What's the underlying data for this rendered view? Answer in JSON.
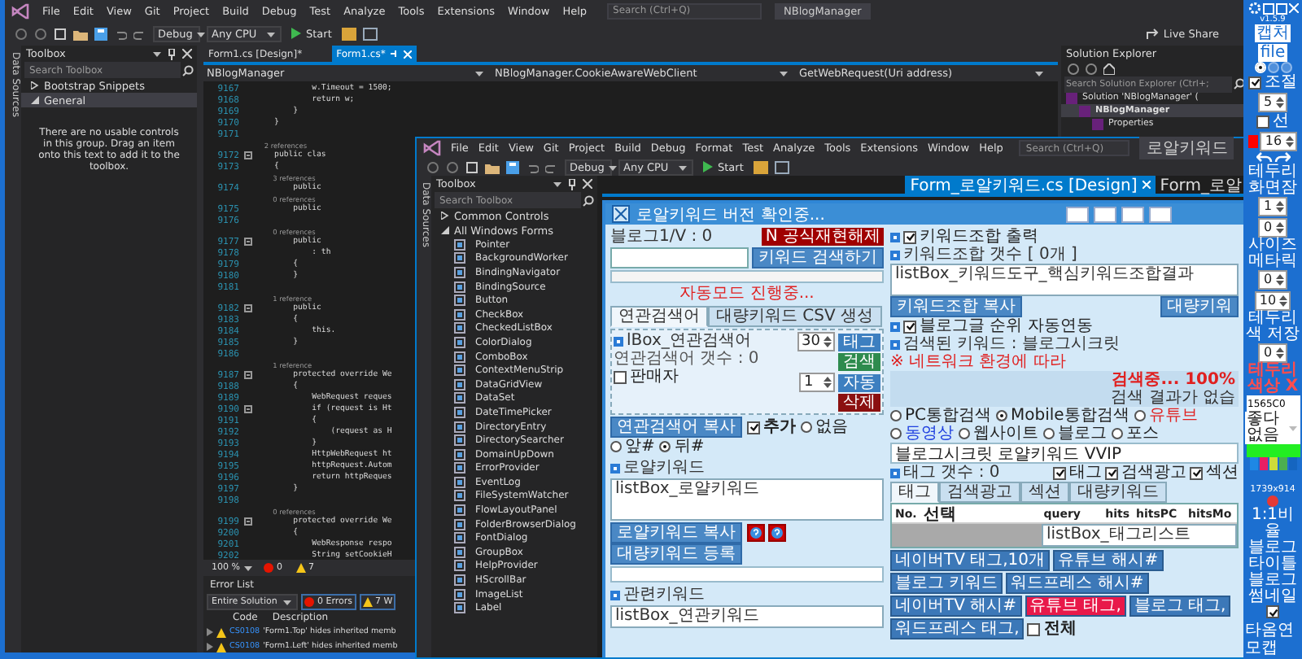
{
  "ide": {
    "menu": [
      "File",
      "Edit",
      "View",
      "Git",
      "Project",
      "Build",
      "Debug",
      "Test",
      "Analyze",
      "Tools",
      "Extensions",
      "Window",
      "Help"
    ],
    "search": {
      "placeholder": "Search (Ctrl+Q)"
    },
    "solution_name": "NBlogManager",
    "toolbar": {
      "configuration": "Debug",
      "platform": "Any CPU",
      "start": "Start",
      "live_share": "Live Share"
    },
    "side_tab": "Data Sources",
    "toolbox": {
      "title": "Toolbox",
      "search": {
        "placeholder": "Search Toolbox"
      },
      "groups": [
        {
          "label": "Bootstrap Snippets",
          "expanded": false,
          "selected": false
        },
        {
          "label": "General",
          "expanded": true,
          "selected": true
        }
      ],
      "message": "There are no usable controls in this group. Drag an item onto this text to add it to the toolbox."
    },
    "doc_tabs": [
      {
        "label": "Form1.cs [Design]*",
        "selected": false
      },
      {
        "label": "Form1.cs*",
        "selected": true
      }
    ],
    "nav_bar": [
      "NBlogManager",
      "NBlogManager.CookieAwareWebClient",
      "GetWebRequest(Uri address)"
    ],
    "code_lines": [
      {
        "kind": "code",
        "number": "9167",
        "text": "            w.Timeout = 1500;",
        "fold": false
      },
      {
        "kind": "code",
        "number": "9168",
        "text": "            return w;",
        "fold": false
      },
      {
        "kind": "code",
        "number": "9169",
        "text": "        }",
        "fold": false
      },
      {
        "kind": "code",
        "number": "9170",
        "text": "    }",
        "fold": false
      },
      {
        "kind": "code",
        "number": "9171",
        "fold": false
      },
      {
        "kind": "lens",
        "text": "    2 references"
      },
      {
        "kind": "code",
        "number": "9172",
        "text": "    public clas",
        "fold": true
      },
      {
        "kind": "code",
        "number": "9173",
        "text": "    {",
        "fold": false
      },
      {
        "kind": "lens",
        "text": "        3 references"
      },
      {
        "kind": "code",
        "number": "9174",
        "text": "        public",
        "fold": false
      },
      {
        "kind": "lens",
        "text": "        0 references"
      },
      {
        "kind": "code",
        "number": "9175",
        "text": "        public",
        "fold": false
      },
      {
        "kind": "code",
        "number": "9176",
        "fold": false
      },
      {
        "kind": "lens",
        "text": "        0 references"
      },
      {
        "kind": "code",
        "number": "9177",
        "text": "        public",
        "fold": true
      },
      {
        "kind": "code",
        "number": "9178",
        "text": "            : th",
        "fold": false
      },
      {
        "kind": "code",
        "number": "9179",
        "text": "        {",
        "fold": false
      },
      {
        "kind": "code",
        "number": "9180",
        "text": "        }",
        "fold": false
      },
      {
        "kind": "code",
        "number": "9181",
        "fold": false
      },
      {
        "kind": "lens",
        "text": "        1 reference"
      },
      {
        "kind": "code",
        "number": "9182",
        "text": "        public",
        "fold": true
      },
      {
        "kind": "code",
        "number": "9183",
        "text": "        {",
        "fold": false
      },
      {
        "kind": "code",
        "number": "9184",
        "text": "            this.",
        "fold": false
      },
      {
        "kind": "code",
        "number": "9185",
        "text": "        }",
        "fold": false
      },
      {
        "kind": "code",
        "number": "9186",
        "fold": false
      },
      {
        "kind": "lens",
        "text": "        1 reference"
      },
      {
        "kind": "code",
        "number": "9187",
        "text": "        protected override We",
        "fold": true
      },
      {
        "kind": "code",
        "number": "9188",
        "text": "        {",
        "fold": false
      },
      {
        "kind": "code",
        "number": "9189",
        "text": "            WebRequest reques",
        "fold": false
      },
      {
        "kind": "code",
        "number": "9190",
        "text": "            if (request is Ht",
        "fold": true
      },
      {
        "kind": "code",
        "number": "9191",
        "text": "            {",
        "fold": false
      },
      {
        "kind": "code",
        "number": "9192",
        "text": "                (request as H",
        "fold": false
      },
      {
        "kind": "code",
        "number": "9193",
        "text": "            }",
        "fold": false
      },
      {
        "kind": "code",
        "number": "9194",
        "text": "            HttpWebRequest ht",
        "fold": false
      },
      {
        "kind": "code",
        "number": "9195",
        "text": "            httpRequest.Autom",
        "fold": false
      },
      {
        "kind": "code",
        "number": "9196",
        "text": "            return httpReques",
        "fold": false
      },
      {
        "kind": "code",
        "number": "9197",
        "text": "        }",
        "fold": false
      },
      {
        "kind": "code",
        "number": "9198",
        "fold": false
      },
      {
        "kind": "lens",
        "text": "        0 references"
      },
      {
        "kind": "code",
        "number": "9199",
        "text": "        protected override We",
        "fold": true
      },
      {
        "kind": "code",
        "number": "9200",
        "text": "        {",
        "fold": false
      },
      {
        "kind": "code",
        "number": "9201",
        "text": "            WebResponse respo",
        "fold": false
      },
      {
        "kind": "code",
        "number": "9202",
        "text": "            String setCookieH",
        "fold": false
      }
    ],
    "editor_status": {
      "zoom": "100 %",
      "errors": "0",
      "warnings": "7"
    },
    "error_list": {
      "title": "Error List",
      "scope": "Entire Solution",
      "errors": "0 Errors",
      "warnings": "7 W",
      "columns": [
        "Code",
        "Description"
      ],
      "rows": [
        {
          "code": "CS0108",
          "description": "'Form1.Top' hides inherited memb"
        },
        {
          "code": "CS0108",
          "description": "'Form1.Left' hides inherited memb"
        }
      ]
    },
    "solution_explorer": {
      "title": "Solution Explorer",
      "search": {
        "placeholder": "Search Solution Explorer (Ctrl+;"
      },
      "tree": [
        {
          "label": "Solution 'NBlogManager' (",
          "selected": false,
          "children": [
            {
              "label": "NBlogManager",
              "selected": true,
              "children": [
                {
                  "label": "Properties",
                  "selected": false
                }
              ]
            }
          ]
        }
      ]
    }
  },
  "designer_window": {
    "menu": [
      "File",
      "Edit",
      "View",
      "Git",
      "Project",
      "Build",
      "Debug",
      "Format",
      "Test",
      "Analyze",
      "Tools",
      "Extensions",
      "Window",
      "Help"
    ],
    "search": {
      "placeholder": "Search (Ctrl+Q)"
    },
    "solution_name": "로알키워드",
    "toolbar": {
      "configuration": "Debug",
      "platform": "Any CPU",
      "start": "Start"
    },
    "side_tab": "Data Sources",
    "toolbox": {
      "title": "Toolbox",
      "search": {
        "placeholder": "Search Toolbox"
      },
      "groups": [
        {
          "label": "Common Controls",
          "expanded": false
        },
        {
          "label": "All Windows Forms",
          "expanded": true
        }
      ],
      "items": [
        "Pointer",
        "BackgroundWorker",
        "BindingNavigator",
        "BindingSource",
        "Button",
        "CheckBox",
        "CheckedListBox",
        "ColorDialog",
        "ComboBox",
        "ContextMenuStrip",
        "DataGridView",
        "DataSet",
        "DateTimePicker",
        "DirectoryEntry",
        "DirectorySearcher",
        "DomainUpDown",
        "ErrorProvider",
        "EventLog",
        "FileSystemWatcher",
        "FlowLayoutPanel",
        "FolderBrowserDialog",
        "FontDialog",
        "GroupBox",
        "HelpProvider",
        "HScrollBar",
        "ImageList",
        "Label"
      ]
    },
    "doc_tabs": [
      {
        "label": "Form_로알키워드.cs [Design]",
        "selected": true
      },
      {
        "label": "Form_로알",
        "selected": false
      }
    ],
    "form": {
      "title": "로알키워드 버전 확인중...",
      "left": {
        "blog_label": "블로그1/V : 0",
        "official_button": "N 공식재현해제",
        "search_button": "키워드 검색하기",
        "status": "자동모드 진행중...",
        "tabs": [
          {
            "label": "연관검색어",
            "selected": true
          },
          {
            "label": "대량키워드 CSV 생성",
            "selected": false
          }
        ],
        "seller": {
          "label": "판매자",
          "checked": false
        },
        "related_list": "lBox_연관검색어",
        "related_count": "연관검색어 갯수 : 0",
        "actions": [
          {
            "value": "30",
            "label": "태그",
            "color": "#3d7fc0"
          },
          {
            "label": "검색",
            "color": "#2e8b4e"
          },
          {
            "value": "1",
            "label": "자동",
            "color": "#3d7fc0"
          },
          {
            "label": "삭제",
            "color": "#8b1010"
          }
        ],
        "copy_button": "연관검색어 복사",
        "add": {
          "label": "추가",
          "checked": true
        },
        "position": [
          {
            "label": "없음",
            "selected": false
          },
          {
            "label": "앞#",
            "selected": false
          },
          {
            "label": "뒤#",
            "selected": true
          }
        ],
        "royal_title": "로얄키워드",
        "royal_list": "listBox_로얄키워드",
        "royal_copy": "로얄키워드 복사",
        "royal_bulk": "대량키워드 등록",
        "related_title": "관련키워드",
        "related_keywords": "listBox_연관키워드"
      },
      "right": {
        "combo": {
          "label": "키워드조합 출력",
          "checked": true
        },
        "combo_count": "키워드조합 갯수 [ 0개 ]",
        "combo_list": "listBox_키워드도구_핵심키워드조합결과",
        "combo_copy": "키워드조합 복사",
        "bulk_button": "대량키워",
        "auto_rank": {
          "label": "블로그글 순위 자동연동",
          "checked": true
        },
        "searched": "검색된 키워드 : 블로그시크릿",
        "network_note": "※ 네트워크 환경에 따라",
        "progress": "검색중... 100%",
        "no_result": "검색 결과가 없습",
        "search_types": [
          {
            "label": "PC통합검색",
            "selected": false,
            "color": "#222222"
          },
          {
            "label": "Mobile통합검색",
            "selected": true,
            "color": "#222222"
          },
          {
            "label": "유튜브",
            "selected": false,
            "color": "#e02020"
          },
          {
            "label": "동영상",
            "selected": false,
            "color": "#2040e0"
          },
          {
            "label": "웹사이트",
            "selected": false,
            "color": "#222222"
          },
          {
            "label": "블로그",
            "selected": false,
            "color": "#222222"
          },
          {
            "label": "포스",
            "selected": false,
            "color": "#222222"
          }
        ],
        "query": {
          "value": "블로그시크릿 로얄키워드 VVIP"
        },
        "tag_count": "태그 갯수 : 0",
        "filters": [
          {
            "label": "태그",
            "checked": true
          },
          {
            "label": "검색광고",
            "checked": true
          },
          {
            "label": "섹션",
            "checked": true
          }
        ],
        "result_tabs": [
          {
            "label": "태그",
            "selected": true
          },
          {
            "label": "검색광고",
            "selected": false
          },
          {
            "label": "섹션",
            "selected": false
          },
          {
            "label": "대량키워드",
            "selected": false
          }
        ],
        "columns": [
          "No.",
          "선택",
          "query",
          "hits",
          "hitsPC",
          "hitsMo"
        ],
        "tag_list": "listBox_태그리스트",
        "share_buttons": [
          {
            "label": "네이버TV 태그,10개",
            "active": false
          },
          {
            "label": "유튜브 해시#",
            "active": false
          },
          {
            "label": "블로그 키워드",
            "active": false
          },
          {
            "label": "워드프레스 해시#",
            "active": false
          },
          {
            "label": "네이버TV 해시#",
            "active": false
          },
          {
            "label": "유튜브 태그,",
            "active": true
          },
          {
            "label": "블로그 태그,",
            "active": false
          },
          {
            "label": "워드프레스 태그,",
            "active": false
          }
        ],
        "all": {
          "label": "전체",
          "checked": false
        }
      }
    }
  },
  "capture_panel": {
    "version": "v1.5.9",
    "buttons": [
      "캡처",
      "file"
    ],
    "modes": [
      {
        "selected": true
      },
      {
        "selected": false
      },
      {
        "selected": false
      }
    ],
    "adjust": {
      "label": "조절",
      "checked": true,
      "value": "5"
    },
    "line": {
      "label": "선",
      "checked": false,
      "color": "#ff0000",
      "value": "16"
    },
    "spin_groups": [
      {
        "label": "테두리 화면잠",
        "values": [
          "1",
          "0"
        ]
      },
      {
        "label": "사이즈 메타릭",
        "values": [
          "0",
          "10"
        ]
      },
      {
        "label": "테두리색 저장",
        "values": [
          "0"
        ]
      }
    ],
    "reset": "테두리색상 X",
    "hex": "1565C0",
    "style": "좋다없음",
    "swatches": [
      {
        "color": "#1e88e5"
      },
      {
        "color": "#e91e63"
      },
      {
        "color": "#cddc39"
      },
      {
        "color": "#4caf50"
      },
      {
        "color": "#1565c0"
      }
    ],
    "resolution": "1739x914",
    "options": [
      "1:1비율",
      "블로그타이틀",
      "블로그썸네일"
    ],
    "last": {
      "label": "타옴연모캡",
      "checked": true
    }
  }
}
